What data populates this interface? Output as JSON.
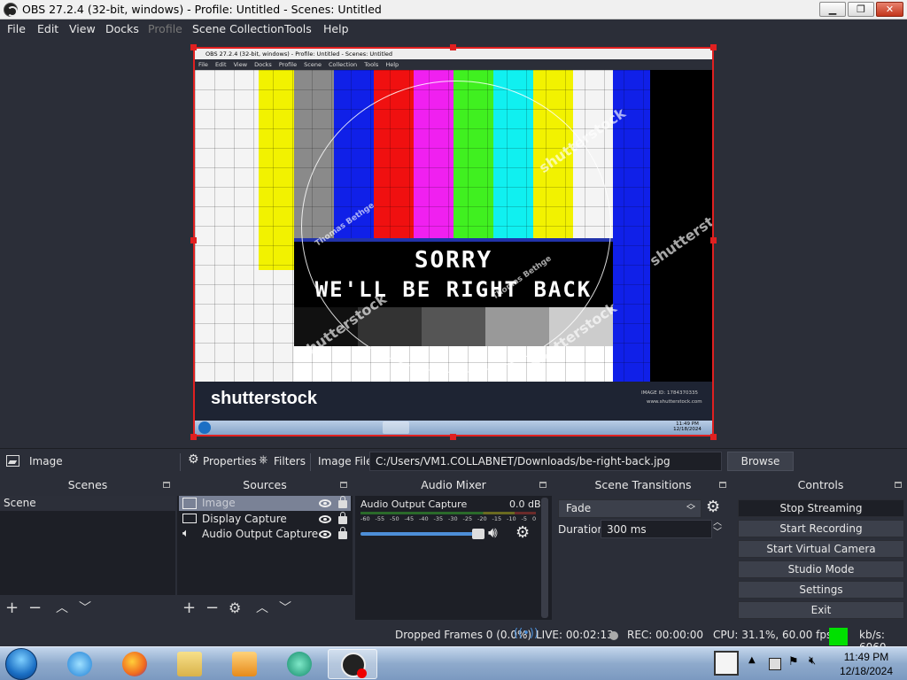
{
  "window": {
    "title": "OBS 27.2.4 (32-bit, windows) - Profile: Untitled - Scenes: Untitled",
    "min_label": "▁",
    "max_label": "❐",
    "close_label": "✕"
  },
  "menu": [
    "File",
    "Edit",
    "View",
    "Docks",
    "Profile",
    "Scene Collection",
    "Tools",
    "Help"
  ],
  "preview": {
    "inner_title": "OBS 27.2.4 (32-bit, windows) - Profile: Untitled - Scenes: Untitled",
    "inner_menu": "File Edit View Docks Profile Scene Collection Tools Help",
    "sorry_line1": "SORRY",
    "sorry_line2": "WE'LL BE RIGHT BACK",
    "brand": "shutterstock",
    "watermark": "shutterstock",
    "watermark_author": "Thomas Bethge",
    "image_id": "IMAGE ID: 1784370335",
    "site": "www.shutterstock.com",
    "inner_clock_time": "11:49 PM",
    "inner_clock_date": "12/18/2024"
  },
  "source_toolbar": {
    "selected_source": "Image",
    "properties_label": "Properties",
    "filters_label": "Filters",
    "image_file_label": "Image File",
    "path": "C:/Users/VM1.COLLABNET/Downloads/be-right-back.jpg",
    "browse_label": "Browse"
  },
  "scenes": {
    "title": "Scenes",
    "items": [
      "Scene"
    ]
  },
  "sources": {
    "title": "Sources",
    "items": [
      {
        "name": "Image",
        "icon": "image-icon",
        "selected": true
      },
      {
        "name": "Display Capture",
        "icon": "monitor-icon",
        "selected": false
      },
      {
        "name": "Audio Output Capture",
        "icon": "speaker-icon",
        "selected": false
      }
    ]
  },
  "audio_mixer": {
    "title": "Audio Mixer",
    "channel": "Audio Output Capture",
    "level": "0.0 dB",
    "scale": [
      "-60",
      "-55",
      "-50",
      "-45",
      "-40",
      "-35",
      "-30",
      "-25",
      "-20",
      "-15",
      "-10",
      "-5",
      "0"
    ],
    "volume_fraction": 1.0
  },
  "transitions": {
    "title": "Scene Transitions",
    "selected": "Fade",
    "duration_label": "Duration",
    "duration_value": "300 ms"
  },
  "controls": {
    "title": "Controls",
    "buttons": [
      "Stop Streaming",
      "Start Recording",
      "Start Virtual Camera",
      "Studio Mode",
      "Settings",
      "Exit"
    ]
  },
  "status": {
    "dropped": "Dropped Frames 0 (0.0%)",
    "live": "LIVE: 00:02:13",
    "rec": "REC: 00:00:00",
    "cpu": "CPU: 31.1%, 60.00 fps",
    "kbps": "kb/s: 6060",
    "health_color": "#00e000"
  },
  "taskbar": {
    "time": "11:49 PM",
    "date": "12/18/2024"
  },
  "colors": {
    "accent_red": "#e02020",
    "panel_bg": "#2b2e38",
    "list_bg": "#1d1f26",
    "button_bg": "#3c404b"
  }
}
